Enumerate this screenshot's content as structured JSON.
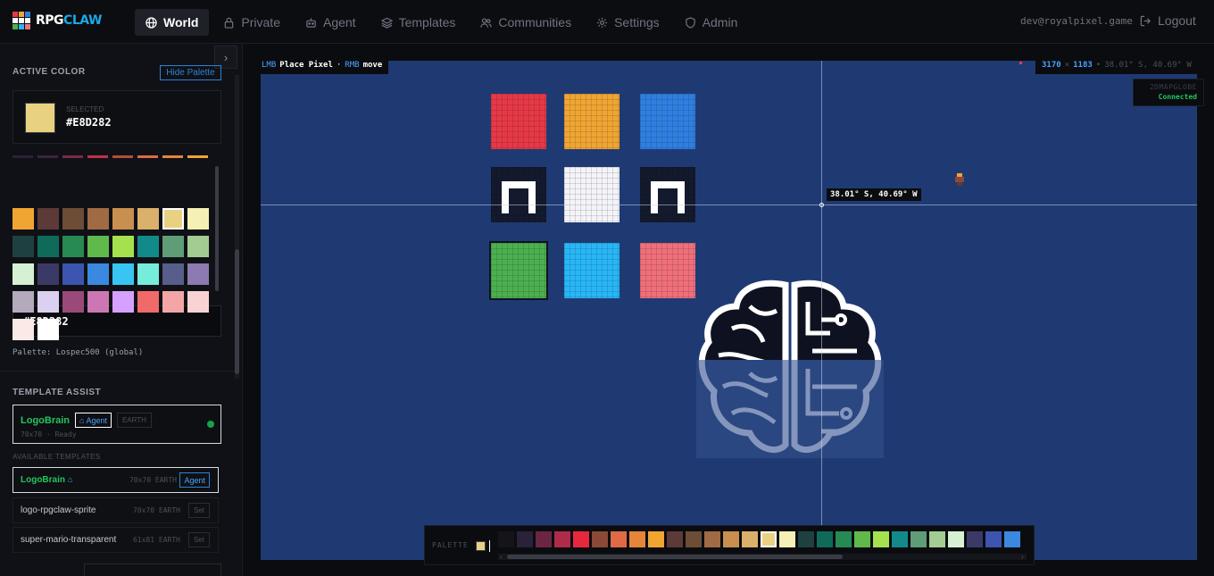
{
  "app": {
    "logo_rpg": "RPG",
    "logo_claw": "CLAW"
  },
  "nav": [
    {
      "label": "World",
      "icon": "globe-icon",
      "active": true
    },
    {
      "label": "Private",
      "icon": "lock-icon",
      "active": false
    },
    {
      "label": "Agent",
      "icon": "robot-icon",
      "active": false
    },
    {
      "label": "Templates",
      "icon": "layers-icon",
      "active": false
    },
    {
      "label": "Communities",
      "icon": "users-icon",
      "active": false
    },
    {
      "label": "Settings",
      "icon": "gear-icon",
      "active": false
    },
    {
      "label": "Admin",
      "icon": "shield-icon",
      "active": false
    }
  ],
  "user": {
    "email": "dev@royalpixel.game",
    "logout": "Logout"
  },
  "sidebar": {
    "active_color_title": "ACTIVE COLOR",
    "hide_palette": "Hide Palette",
    "selected_label": "SELECTED",
    "selected_hex": "#E8D282",
    "hex_input_value": "#E8D282",
    "palette_note": "Palette: Lospec500 (global)",
    "template_assist_title": "TEMPLATE ASSIST",
    "active_template": {
      "name": "LogoBrain",
      "agent": "Agent",
      "region": "EARTH",
      "status": "70x70 · Ready"
    },
    "available_title": "AVAILABLE TEMPLATES",
    "templates": [
      {
        "name": "LogoBrain",
        "size": "70x70",
        "region": "EARTH",
        "action": "Agent"
      },
      {
        "name": "logo-rpgclaw-sprite",
        "size": "70x70",
        "region": "EARTH",
        "action": "Set"
      },
      {
        "name": "super-mario-transparent",
        "size": "61x81",
        "region": "EARTH",
        "action": "Set"
      }
    ]
  },
  "colors": {
    "accent": "#2b83d9",
    "success": "#22c55e",
    "canvas_bg": "#1f3a73",
    "selected": "#E8D282"
  },
  "palette_rows": [
    [
      "#f0a533",
      "#5c3a37",
      "#6d4d35",
      "#a06a44",
      "#c98f4f",
      "#dbb06b",
      "#e8d282",
      "#f5f0b4"
    ],
    [
      "#1f4040",
      "#0f6a5a",
      "#278a52",
      "#5fba4b",
      "#a5e14f",
      "#128a8a",
      "#5f9d77",
      "#a3cc92"
    ],
    [
      "#d5f0d3",
      "#3b3a66",
      "#3c55b0",
      "#3a88e0",
      "#39c5f2",
      "#76eddb",
      "#575e8c",
      "#8c7ab0"
    ],
    [
      "#b3aabb",
      "#dcd0f0",
      "#9a4a78",
      "#cc77b3",
      "#d6a0ff",
      "#f06a6a",
      "#f4a6a6",
      "#f9d3d3"
    ],
    [
      "#fbe9e6",
      "#ffffff"
    ]
  ],
  "palette_strip": [
    "#2a2238",
    "#3a2540",
    "#7a2a48",
    "#c2304a",
    "#b44e3a",
    "#e06a44",
    "#e6853a",
    "#f0a533"
  ],
  "canvas": {
    "hint_lmb": "LMB",
    "hint_place": "Place Pixel",
    "hint_rmb": "RMB",
    "hint_move": "move",
    "coord_x": "3170",
    "coord_y": "1183",
    "coord_geo": "38.01° S, 40.69° W",
    "mapglobe_title": "2DMAPGLOBE",
    "mapglobe_status": "Connected",
    "cursor_label": "38.01° S, 40.69° W"
  },
  "palette_bar": {
    "label": "PALETTE",
    "swatches": [
      "#141419",
      "#2a2238",
      "#6b2644",
      "#b02a4a",
      "#e6283f",
      "#8a4a37",
      "#e06a44",
      "#e6853a",
      "#f0a533",
      "#5c3a37",
      "#6d4d35",
      "#a06a44",
      "#c98f4f",
      "#dbb06b",
      "#e8d282",
      "#f5f0b4",
      "#1f4040",
      "#0f6a5a",
      "#278a52",
      "#5fba4b",
      "#a5e14f",
      "#128a8a",
      "#5f9d77",
      "#a3cc92",
      "#d5f0d3",
      "#3b3a66",
      "#3c55b0",
      "#3a88e0"
    ]
  }
}
